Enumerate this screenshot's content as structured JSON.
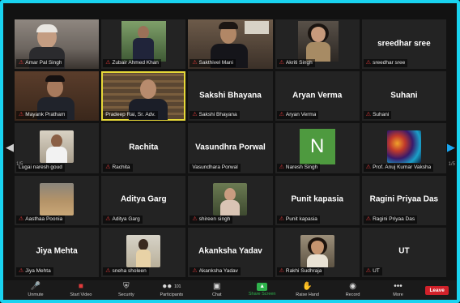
{
  "participants": [
    {
      "name": "Amar Pal Singh",
      "type": "video",
      "video": "elderly-man-white-hair"
    },
    {
      "name": "Zubair Ahmed Khan",
      "type": "video",
      "video": "man-suit-outdoor"
    },
    {
      "name": "Sakthivel Mani",
      "type": "video",
      "video": "young-man-office"
    },
    {
      "name": "Akriti Singh",
      "type": "video",
      "video": "woman-bookshelf"
    },
    {
      "name": "sreedhar sree",
      "type": "name"
    },
    {
      "name": "Mayank Pratham",
      "type": "video",
      "video": "man-glasses-bookshelf"
    },
    {
      "name": "Pradeep Rai, Sr. Adv.",
      "type": "video",
      "video": "man-law-library",
      "active": true
    },
    {
      "name": "Sakshi Bhayana",
      "type": "name"
    },
    {
      "name": "Aryan Verma",
      "type": "name"
    },
    {
      "name": "Suhani",
      "type": "name"
    },
    {
      "name": "Lugai naresh goud",
      "type": "photo",
      "video": "man-white-shirt"
    },
    {
      "name": "Rachita",
      "type": "name"
    },
    {
      "name": "Vasundhra Porwal",
      "type": "name",
      "label": "Vasundhara Porwal"
    },
    {
      "name": "Naresh Singh",
      "type": "initial",
      "initial": "N"
    },
    {
      "name": "Prof. Anuj Kumar Vaksha",
      "type": "photo",
      "video": "colorful-art"
    },
    {
      "name": "Aasthaa Poonia",
      "type": "photo",
      "video": "desert-sky"
    },
    {
      "name": "Aditya Garg",
      "type": "name"
    },
    {
      "name": "shireen singh",
      "type": "photo",
      "video": "woman-garden"
    },
    {
      "name": "Punit kapasia",
      "type": "name"
    },
    {
      "name": "Ragini Priyaa Das",
      "type": "name"
    },
    {
      "name": "Jiya Mehta",
      "type": "name"
    },
    {
      "name": "sneha sholeen",
      "type": "photo",
      "video": "woman-outdoor"
    },
    {
      "name": "Akanksha Yadav",
      "type": "name"
    },
    {
      "name": "Rakhi Sudhraja",
      "type": "photo",
      "video": "woman-smiling"
    },
    {
      "name": "UT",
      "type": "name"
    }
  ],
  "pagination": {
    "left": "1/5",
    "right": "1/5"
  },
  "toolbar": {
    "unmute": "Unmute",
    "start_video": "Start Video",
    "security": "Security",
    "participants": "Participants",
    "participants_count": "101",
    "chat": "Chat",
    "share_screen": "Share Screen",
    "raise_hand": "Raise Hand",
    "record": "Record",
    "more": "More",
    "leave": "Leave"
  },
  "colors": {
    "border": "#19d3f0",
    "active_speaker": "#e6d838",
    "share": "#2fb24c",
    "leave": "#d1212a",
    "muted_mic": "#e23b3b"
  }
}
